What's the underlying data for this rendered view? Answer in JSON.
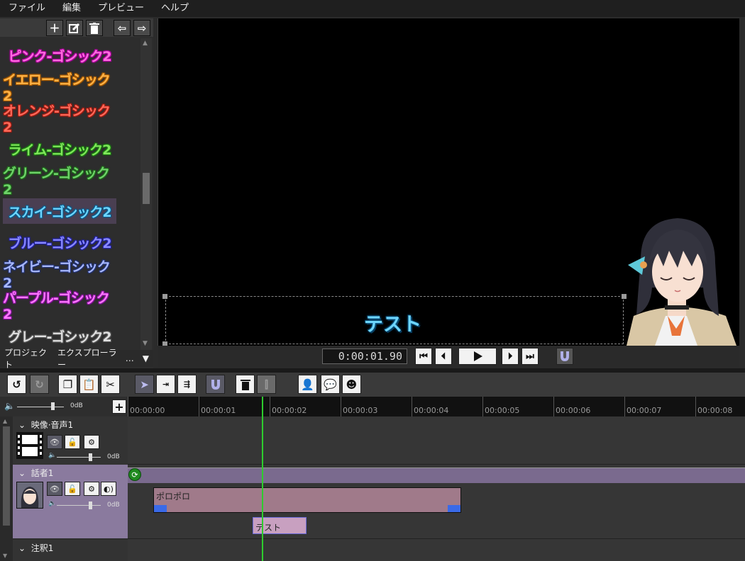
{
  "menu": [
    "ファイル",
    "編集",
    "プレビュー",
    "ヘルプ"
  ],
  "font_presets": [
    {
      "label": "ピンク-ゴシック2",
      "color": "#ff6ee0",
      "outline": "#b000a0"
    },
    {
      "label": "イエロー-ゴシック2",
      "color": "#ffb347",
      "outline": "#a85a00"
    },
    {
      "label": "オレンジ-ゴシック2",
      "color": "#ff6a5a",
      "outline": "#a01a10"
    },
    {
      "label": "ライム-ゴシック2",
      "color": "#7fe65a",
      "outline": "#1a7a10"
    },
    {
      "label": "グリーン-ゴシック2",
      "color": "#6fd36a",
      "outline": "#1f6a1a"
    },
    {
      "label": "スカイ-ゴシック2",
      "color": "#6ed6ff",
      "outline": "#0a5a8a",
      "selected": true
    },
    {
      "label": "ブルー-ゴシック2",
      "color": "#8a8aff",
      "outline": "#2020a0"
    },
    {
      "label": "ネイビー-ゴシック2",
      "color": "#a8b8ff",
      "outline": "#203070"
    },
    {
      "label": "パープル-ゴシック2",
      "color": "#ff7aff",
      "outline": "#8a10a0"
    },
    {
      "label": "グレー-ゴシック2",
      "color": "#e0e0e0",
      "outline": "#555555"
    }
  ],
  "panel_tabs": [
    "プロジェクト",
    "エクスプローラー",
    "…",
    "▼"
  ],
  "preview": {
    "caption": "テスト"
  },
  "transport": {
    "timecode": "0:00:01.90"
  },
  "master": {
    "db": "0dB"
  },
  "ruler_ticks": [
    "00:00:00",
    "00:00:01",
    "00:00:02",
    "00:00:03",
    "00:00:04",
    "00:00:05",
    "00:00:06",
    "00:00:07",
    "00:00:08"
  ],
  "tracks": [
    {
      "name": "映像·音声1",
      "db": "0dB"
    },
    {
      "name": "話者1",
      "db": "0dB"
    },
    {
      "name": "注釈1"
    }
  ],
  "clips": {
    "speech": "ポロポロ",
    "text": "テスト"
  },
  "colors": {
    "accent_purple": "#7a6a8e",
    "speech_clip": "#a07a8a",
    "text_clip": "#c8a0c0",
    "playhead": "#2ecc2e"
  }
}
